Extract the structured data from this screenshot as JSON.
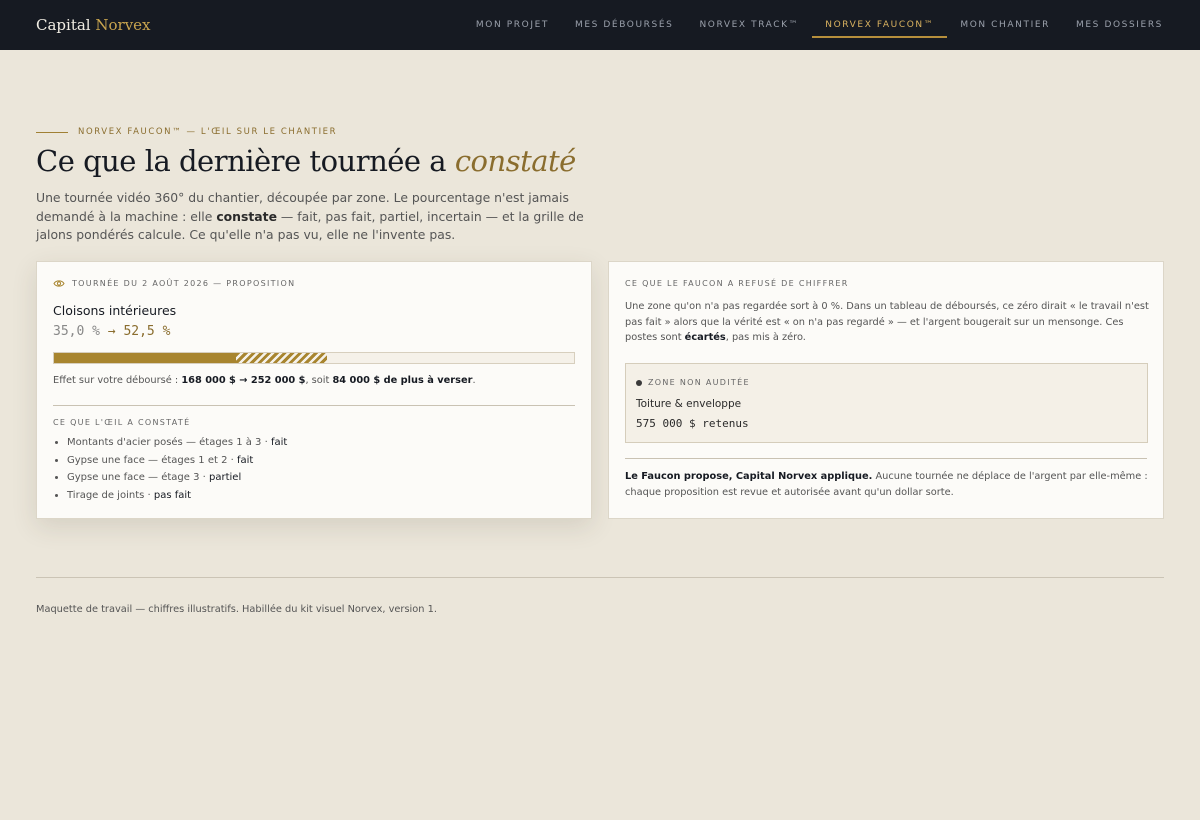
{
  "brand": {
    "name": "Capital",
    "accent": "Norvex"
  },
  "nav": {
    "items": [
      {
        "label": "MON PROJET"
      },
      {
        "label": "MES DÉBOURSÉS"
      },
      {
        "label": "NORVEX TRACK™"
      },
      {
        "label": "NORVEX FAUCON™",
        "active": true
      },
      {
        "label": "MON CHANTIER"
      },
      {
        "label": "MES DOSSIERS"
      }
    ]
  },
  "header": {
    "eyebrow": "NORVEX FAUCON™ — L'ŒIL SUR LE CHANTIER",
    "title_plain": "Ce que la dernière tournée a ",
    "title_em": "constaté",
    "intro_1": "Une tournée vidéo 360° du chantier, découpée par zone. Le pourcentage n'est jamais demandé à la machine : elle ",
    "intro_bold": "constate",
    "intro_2": " — fait, pas fait, partiel, incertain — et la grille de jalons pondérés calcule. Ce qu'elle n'a pas vu, elle ne l'invente pas."
  },
  "tour_card": {
    "eye_icon": "eye-icon",
    "heading": "TOURNÉE DU 2 AOÛT 2026 — PROPOSITION",
    "zone": "Cloisons intérieures",
    "pct_from": "35,0 %",
    "arrow": "→",
    "pct_to": "52,5 %",
    "progress": {
      "previous_percent": 35.0,
      "proposed_percent": 52.5
    },
    "effect_prefix": "Effet sur votre déboursé : ",
    "effect_amounts": "168 000 $ → 252 000 $",
    "effect_mid": ", soit ",
    "effect_delta": "84 000 $ de plus à verser",
    "effect_end": ".",
    "observed_title": "CE QUE L'ŒIL A CONSTATÉ",
    "observations": [
      {
        "text": "Montants d'acier posés — étages 1 à 3 · ",
        "status": "fait"
      },
      {
        "text": "Gypse une face — étages 1 et 2 · ",
        "status": "fait"
      },
      {
        "text": "Gypse une face — étage 3 · ",
        "status": "partiel"
      },
      {
        "text": "Tirage de joints · ",
        "status": "pas fait"
      }
    ]
  },
  "refused_card": {
    "heading": "CE QUE LE FAUCON A REFUSÉ DE CHIFFRER",
    "text_1": "Une zone qu'on n'a pas regardée sort à 0 %. Dans un tableau de déboursés, ce zéro dirait « le travail n'est pas fait » alors que la vérité est « on n'a pas regardé » — et l'argent bougerait sur un mensonge. Ces postes sont ",
    "text_bold": "écartés",
    "text_2": ", pas mis à zéro.",
    "unaudited_label": "ZONE NON AUDITÉE",
    "unaudited_zone": "Toiture & enveloppe",
    "unaudited_amount": "575 000 $ retenus",
    "foot_bold": "Le Faucon propose, Capital Norvex applique.",
    "foot_text": " Aucune tournée ne déplace de l'argent par elle-même : chaque proposition est revue et autorisée avant qu'un dollar sorte."
  },
  "footnote": "Maquette de travail — chiffres illustratifs. Habillée du kit visuel Norvex, version 1.",
  "colors": {
    "gold": "#a8852f",
    "navy": "#161a22",
    "page_bg": "#ebe6da"
  }
}
